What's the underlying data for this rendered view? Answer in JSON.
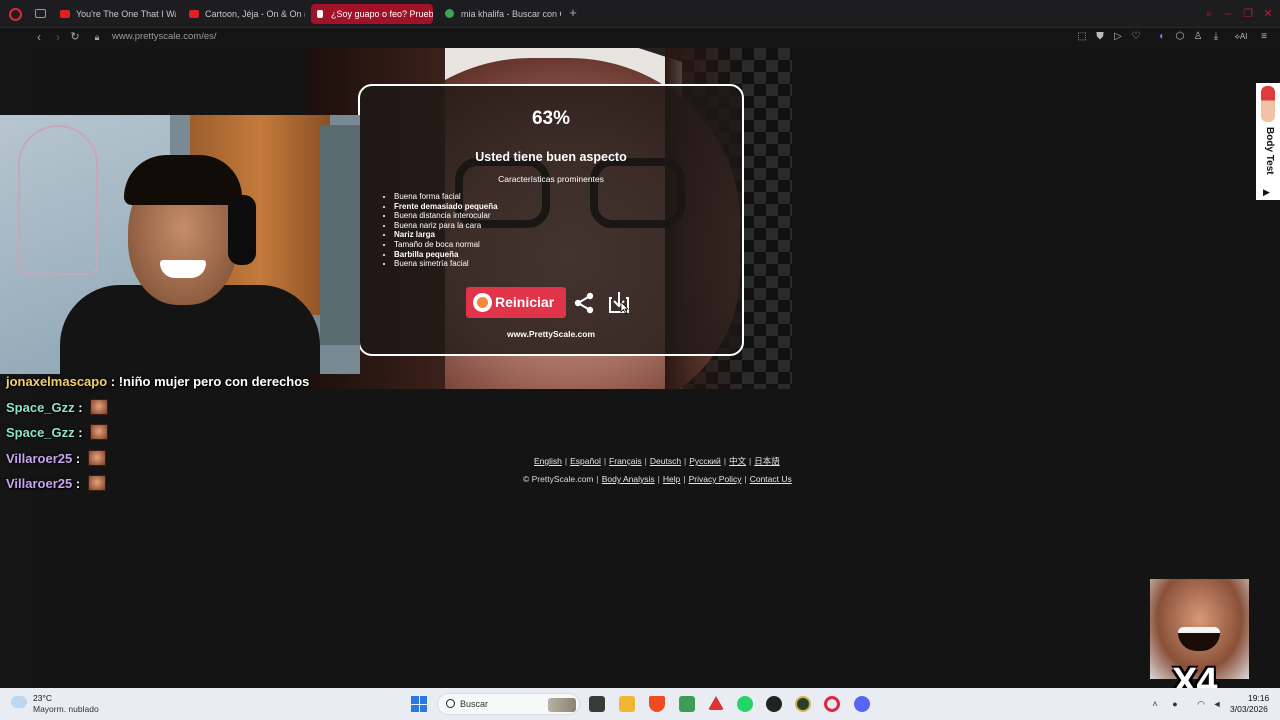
{
  "browser": {
    "tabs": [
      {
        "label": "You're The One That I Wa",
        "active": false,
        "favicon_color": "#e02020"
      },
      {
        "label": "Cartoon, Jéja - On & On (f",
        "active": false,
        "favicon_color": "#e02020"
      },
      {
        "label": "¿Soy guapo o feo? Prueb",
        "active": true,
        "favicon_color": "#ffffff"
      },
      {
        "label": "mia khalifa - Buscar con G",
        "active": false,
        "favicon_color": "#34a853"
      }
    ],
    "url": "www.prettyscale.com/es/",
    "accent_color": "#a11228"
  },
  "result": {
    "score": "63%",
    "verdict": "Usted tiene buen aspecto",
    "subtitle": "Características prominentes",
    "features": [
      {
        "text": "Buena forma facial",
        "bold": false
      },
      {
        "text": "Frente demasiado pequeña",
        "bold": true
      },
      {
        "text": "Buena distancia interocular",
        "bold": false
      },
      {
        "text": "Buena nariz para la cara",
        "bold": false
      },
      {
        "text": "Nariz larga",
        "bold": true
      },
      {
        "text": "Tamaño de boca normal",
        "bold": false
      },
      {
        "text": "Barbilla pequeña",
        "bold": true
      },
      {
        "text": "Buena simetría facial",
        "bold": false
      }
    ],
    "restart_label": "Reiniciar",
    "site_url": "www.PrettyScale.com",
    "icons": [
      "restart-icon",
      "share-icon",
      "download-icon"
    ]
  },
  "footer": {
    "languages": [
      "English",
      "Español",
      "Français",
      "Deutsch",
      "Русский",
      "中文",
      "日本語"
    ],
    "copyright": "© PrettyScale.com",
    "links": [
      "Body Analysis",
      "Help",
      "Privacy Policy",
      "Contact Us"
    ]
  },
  "side_ad": {
    "label": "Body Test",
    "arrow": "▶"
  },
  "chat": [
    {
      "user": "jonaxelmascapo",
      "sep": " : ",
      "msg": "!niño mujer pero con derechos",
      "emote": false,
      "style": "gold"
    },
    {
      "user": "Space_Gzz",
      "sep": " : ",
      "msg": "",
      "emote": true,
      "style": "teal"
    },
    {
      "user": "Space_Gzz",
      "sep": " : ",
      "msg": "",
      "emote": true,
      "style": "teal"
    },
    {
      "user": "Villaroer25",
      "sep": " : ",
      "msg": "",
      "emote": true,
      "style": "purple"
    },
    {
      "user": "Villaroer25",
      "sep": " : ",
      "msg": "",
      "emote": true,
      "style": "purple"
    }
  ],
  "meme": {
    "multiplier": "X4"
  },
  "taskbar": {
    "weather_temp": "23°C",
    "weather_desc": "Mayorm. nublado",
    "search_placeholder": "Buscar",
    "time": "19:16",
    "date": "3/03/2026"
  }
}
